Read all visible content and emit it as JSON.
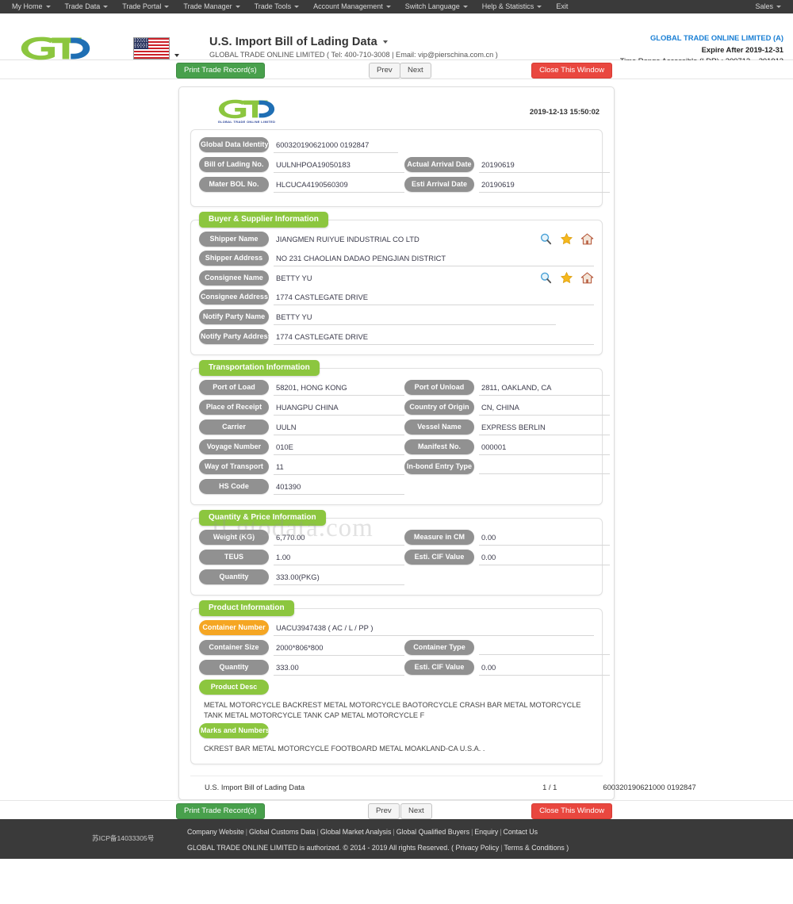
{
  "topnav": {
    "left_items": [
      {
        "label": "My Home",
        "caret": true
      },
      {
        "label": "Trade Data",
        "caret": true
      },
      {
        "label": "Trade Portal",
        "caret": true
      },
      {
        "label": "Trade Manager",
        "caret": true
      },
      {
        "label": "Trade Tools",
        "caret": true
      },
      {
        "label": "Account Management",
        "caret": true
      },
      {
        "label": "Switch Language",
        "caret": true
      },
      {
        "label": "Help & Statistics",
        "caret": true
      },
      {
        "label": "Exit",
        "caret": false
      }
    ],
    "right_items": [
      {
        "label": "Sales",
        "caret": true
      }
    ]
  },
  "header": {
    "logo_caption": "GLOBAL TRADE ONLINE LIMITED",
    "flag_alt": "us-flag",
    "title": "U.S. Import Bill of Lading Data",
    "subtitle": "GLOBAL TRADE ONLINE LIMITED ( Tel: 400-710-3008 | Email: vip@pierschina.com.cn )",
    "account": "GLOBAL TRADE ONLINE LIMITED (A)",
    "expire": "Expire After 2019-12-31",
    "time_range": "Time Range Accessible (LDR) : 200712 ~ 201912"
  },
  "actionbar": {
    "print_label": "Print Trade Record(s)",
    "prev_label": "Prev",
    "next_label": "Next",
    "close_label": "Close This Window"
  },
  "document": {
    "logo_caption": "GLOBAL TRADE ONLINE LIMITED",
    "timestamp": "2019-12-13 15:50:02",
    "watermark": "tl.gtodata.com",
    "identity": {
      "global_data_identity_label": "Global Data Identity",
      "global_data_identity_value": "600320190621000 0192847",
      "bill_of_lading_label": "Bill of Lading No.",
      "bill_of_lading_value": "UULNHPOA19050183",
      "actual_arrival_label": "Actual Arrival Date",
      "actual_arrival_value": "20190619",
      "master_bol_label": "Mater BOL No.",
      "master_bol_value": "HLCUCA4190560309",
      "esti_arrival_label": "Esti Arrival Date",
      "esti_arrival_value": "20190619"
    },
    "buyer_supplier": {
      "title": "Buyer & Supplier Information",
      "shipper_name_label": "Shipper Name",
      "shipper_name_value": "JIANGMEN RUIYUE INDUSTRIAL CO LTD",
      "shipper_address_label": "Shipper Address",
      "shipper_address_value": "NO 231 CHAOLIAN DADAO PENGJIAN DISTRICT",
      "consignee_name_label": "Consignee Name",
      "consignee_name_value": "BETTY YU",
      "consignee_address_label": "Consignee Address",
      "consignee_address_value": "1774 CASTLEGATE DRIVE",
      "notify_party_name_label": "Notify Party Name",
      "notify_party_name_value": "BETTY YU",
      "notify_party_address_label": "Notify Party Address",
      "notify_party_address_value": "1774 CASTLEGATE DRIVE"
    },
    "transportation": {
      "title": "Transportation Information",
      "port_of_load_label": "Port of Load",
      "port_of_load_value": "58201, HONG KONG",
      "port_of_unload_label": "Port of Unload",
      "port_of_unload_value": "2811, OAKLAND, CA",
      "place_of_receipt_label": "Place of Receipt",
      "place_of_receipt_value": "HUANGPU CHINA",
      "country_of_origin_label": "Country of Origin",
      "country_of_origin_value": "CN, CHINA",
      "carrier_label": "Carrier",
      "carrier_value": "UULN",
      "vessel_name_label": "Vessel Name",
      "vessel_name_value": "EXPRESS BERLIN",
      "voyage_number_label": "Voyage Number",
      "voyage_number_value": "010E",
      "manifest_no_label": "Manifest No.",
      "manifest_no_value": "000001",
      "way_of_transport_label": "Way of Transport",
      "way_of_transport_value": "11",
      "inbond_entry_type_label": "In-bond Entry Type",
      "inbond_entry_type_value": "",
      "hs_code_label": "HS Code",
      "hs_code_value": "401390"
    },
    "quantity_price": {
      "title": "Quantity & Price Information",
      "weight_label": "Weight (KG)",
      "weight_value": "6,770.00",
      "measure_label": "Measure in CM",
      "measure_value": "0.00",
      "teus_label": "TEUS",
      "teus_value": "1.00",
      "esti_cif_label": "Esti. CIF Value",
      "esti_cif_value": "0.00",
      "quantity_label": "Quantity",
      "quantity_value": "333.00(PKG)"
    },
    "product": {
      "title": "Product Information",
      "container_number_label": "Container Number",
      "container_number_value": "UACU3947438 ( AC / L / PP )",
      "container_size_label": "Container Size",
      "container_size_value": "2000*806*800",
      "container_type_label": "Container Type",
      "container_type_value": "",
      "quantity_label": "Quantity",
      "quantity_value": "333.00",
      "esti_cif_label": "Esti. CIF Value",
      "esti_cif_value": "0.00",
      "product_desc_label": "Product Desc",
      "product_desc_value": "METAL MOTORCYCLE BACKREST METAL MOTORCYCLE BAOTORCYCLE CRASH BAR METAL MOTORCYCLE TANK METAL MOTORCYCLE TANK CAP METAL MOTORCYCLE F",
      "marks_label": "Marks and Numbers",
      "marks_value": "CKREST BAR METAL MOTORCYCLE FOOTBOARD METAL MOAKLAND-CA U.S.A. ."
    },
    "footer": {
      "title": "U.S. Import Bill of Lading Data",
      "page": "1 / 1",
      "record_id": "600320190621000 0192847"
    },
    "row_icons": {
      "search": "search-icon",
      "favorite": "star-icon",
      "home": "home-icon"
    }
  },
  "footer": {
    "icp": "苏ICP备14033305号",
    "links": [
      "Company Website",
      "Global Customs Data",
      "Global Market Analysis",
      "Global Qualified Buyers",
      "Enquiry",
      "Contact Us"
    ],
    "copyright_text": "GLOBAL TRADE ONLINE LIMITED is authorized. © 2014 - 2019 All rights Reserved.  (",
    "privacy_label": "Privacy Policy",
    "terms_label": "Terms & Conditions",
    "copyright_close": ")"
  },
  "colors": {
    "brand_green": "#8cc63f",
    "brand_blue": "#1f6fb4",
    "label_grey": "#919191",
    "accent_orange": "#f5a623",
    "nav_dark": "#3a3a3a",
    "print_green": "#48a04c",
    "close_red": "#e9473f"
  }
}
